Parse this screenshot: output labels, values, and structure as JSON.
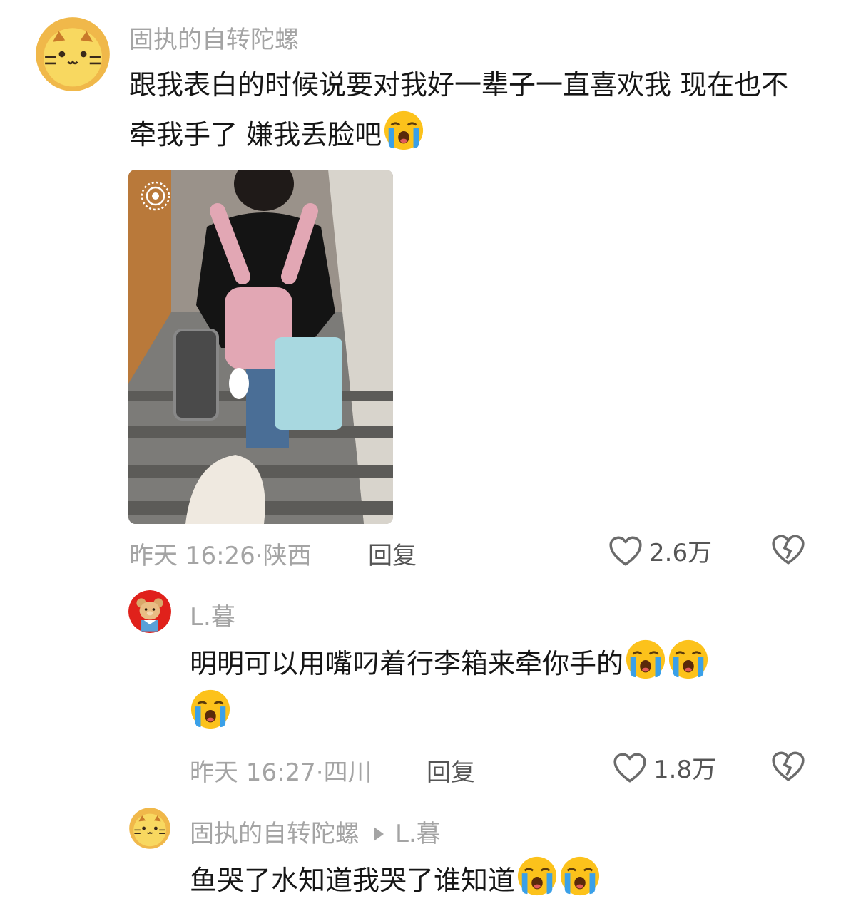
{
  "comments": [
    {
      "username": "固执的自转陀螺",
      "text": "跟我表白的时候说要对我好一辈子一直喜欢我 现在也不牵我手了 嫌我丢脸吧",
      "emoji": "loudly-crying-face",
      "has_live_photo_icon": true,
      "time": "昨天 16:26",
      "location": "陕西",
      "reply_label": "回复",
      "likes": "2.6万"
    },
    {
      "username": "L.暮",
      "text": "明明可以用嘴叼着行李箱来牵你手的",
      "emoji": "loudly-crying-face",
      "time": "昨天 16:27",
      "location": "四川",
      "reply_label": "回复",
      "likes": "1.8万"
    },
    {
      "username": "固执的自转陀螺",
      "reply_to": "L.暮",
      "text": "鱼哭了水知道我哭了谁知道",
      "emoji": "loudly-crying-face"
    }
  ],
  "colors": {
    "secondary_text": "#a4a4a4",
    "primary_text": "#161616",
    "action_text": "#555555"
  }
}
